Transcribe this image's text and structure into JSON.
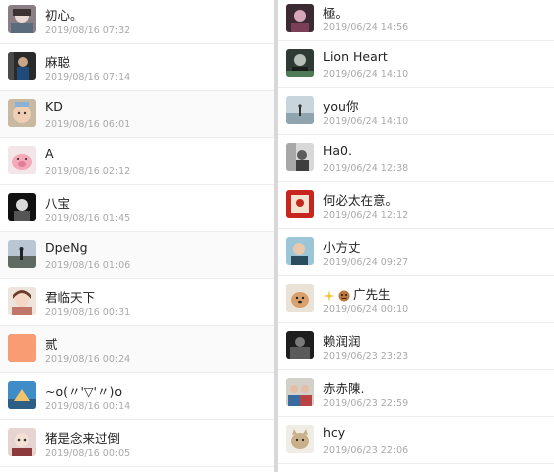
{
  "left": [
    {
      "name": "初心。",
      "time": "2019/08/16 07:32",
      "avatar": "anime-girl"
    },
    {
      "name": "麻聪",
      "time": "2019/08/16 07:14",
      "avatar": "person-dark"
    },
    {
      "name": "KD",
      "time": "2019/08/16 06:01",
      "avatar": "baby"
    },
    {
      "name": "A",
      "time": "2019/08/16 02:12",
      "avatar": "pig"
    },
    {
      "name": "八宝",
      "time": "2019/08/16 01:45",
      "avatar": "dark-figure"
    },
    {
      "name": "DpeNg",
      "time": "2019/08/16 01:06",
      "avatar": "landscape"
    },
    {
      "name": "君临天下",
      "time": "2019/08/16 00:31",
      "avatar": "anime-girl-2"
    },
    {
      "name": "贰",
      "time": "2019/08/16 00:24",
      "avatar": "orange-square"
    },
    {
      "name": "~o(〃'▽'〃)o",
      "time": "2019/08/16 00:14",
      "avatar": "sky-blue"
    },
    {
      "name": "猪是念来过倒",
      "time": "2019/08/16 00:05",
      "avatar": "cartoon"
    }
  ],
  "right": [
    {
      "name": "極。",
      "time": "2019/06/24 14:56",
      "avatar": "dark-pink"
    },
    {
      "name": "Lion Heart",
      "time": "2019/06/24 14:10",
      "avatar": "green-dark"
    },
    {
      "name": "you你",
      "time": "2019/06/24 14:10",
      "avatar": "beach"
    },
    {
      "name": "Ha0.",
      "time": "2019/06/24 12:38",
      "avatar": "gray-person"
    },
    {
      "name": "何必太在意。",
      "time": "2019/06/24 12:12",
      "avatar": "red-card"
    },
    {
      "name": "小方丈",
      "time": "2019/06/24 09:27",
      "avatar": "blue-outdoor"
    },
    {
      "name": "广先生",
      "time": "2019/06/24 00:10",
      "avatar": "dog",
      "has_emoji": true
    },
    {
      "name": "赖润润",
      "time": "2019/06/23 23:23",
      "avatar": "dark-room"
    },
    {
      "name": "赤赤陳.",
      "time": "2019/06/23 22:59",
      "avatar": "group"
    },
    {
      "name": "hcy",
      "time": "2019/06/23 22:06",
      "avatar": "cat"
    }
  ]
}
